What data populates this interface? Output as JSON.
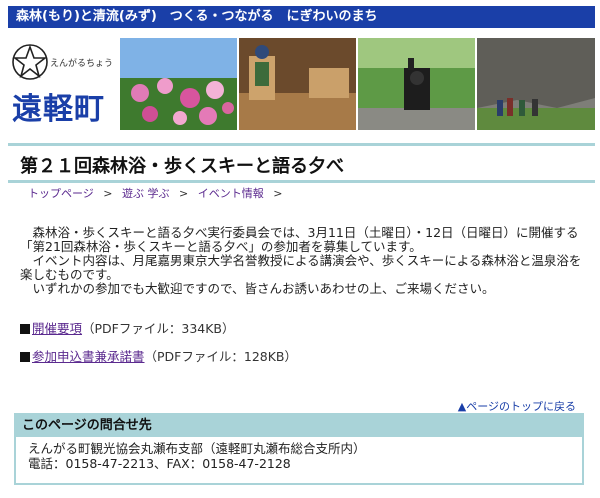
{
  "top_bar": {
    "slogan": "森林(もり)と清流(みず)　つくる・つながる　にぎわいのまち"
  },
  "logo": {
    "reading": "えんがるちょう",
    "town": "遠軽町"
  },
  "page_title": "第２１回森林浴・歩くスキーと語る夕べ",
  "breadcrumb": {
    "items": [
      "トップページ",
      "遊ぶ 学ぶ",
      "イベント情報"
    ],
    "sep": ">"
  },
  "content": {
    "paragraphs": [
      "　森林浴・歩くスキーと語る夕べ実行委員会では、3月11日（土曜日）・12日（日曜日）に開催する「第21回森林浴・歩くスキーと語る夕べ」の参加者を募集しています。",
      "　イベント内容は、月尾嘉男東京大学名誉教授による講演会や、歩くスキーによる森林浴と温泉浴を楽しむものです。",
      "　いずれかの参加でも大歓迎ですので、皆さんお誘いあわせの上、ご来場ください。"
    ]
  },
  "links": [
    {
      "label": "開催要項",
      "note": "（PDFファイル：334KB）"
    },
    {
      "label": "参加申込書兼承諾書",
      "note": "（PDFファイル：128KB）"
    }
  ],
  "to_top": "▲ページのトップに戻る",
  "contact": {
    "heading": "このページの問合せ先",
    "line1": "えんがる町観光協会丸瀬布支部（遠軽町丸瀬布総合支所内）",
    "line2": "電話：0158-47-2213、FAX：0158-47-2128"
  }
}
